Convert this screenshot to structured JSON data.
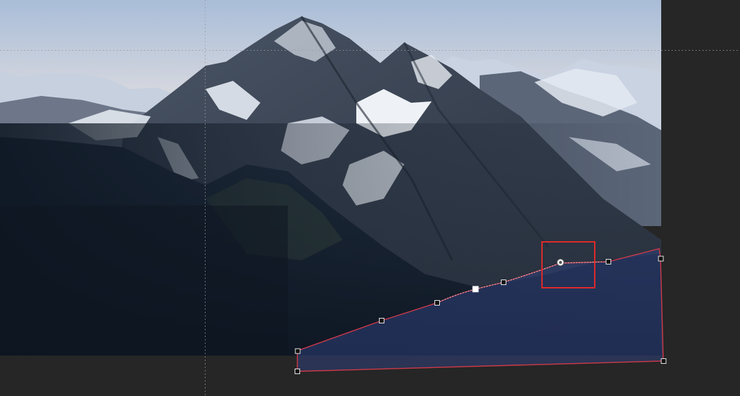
{
  "app": {
    "workspace_bg": "#262626",
    "pasteboard_bg": "#2c2c2c"
  },
  "image": {
    "subject": "mountain-range",
    "sky_top": "#aebfd7",
    "sky_bottom": "#eadfd6",
    "rock": "#3d4655",
    "snow": "#e4e9f1",
    "forest": "#1b2838"
  },
  "selection": {
    "fill": "#2f3f7a",
    "fill_opacity": 0.55,
    "stroke": "#d23a4a",
    "handle_fill": "#111111",
    "handle_stroke": "#e8e8e8",
    "active_handle_fill": "#ffffff"
  },
  "highlight": {
    "stroke": "#e02a2a",
    "icon": "move-anchor-icon"
  },
  "guides": {
    "color": "#9a9a9a",
    "style": "dashed"
  }
}
